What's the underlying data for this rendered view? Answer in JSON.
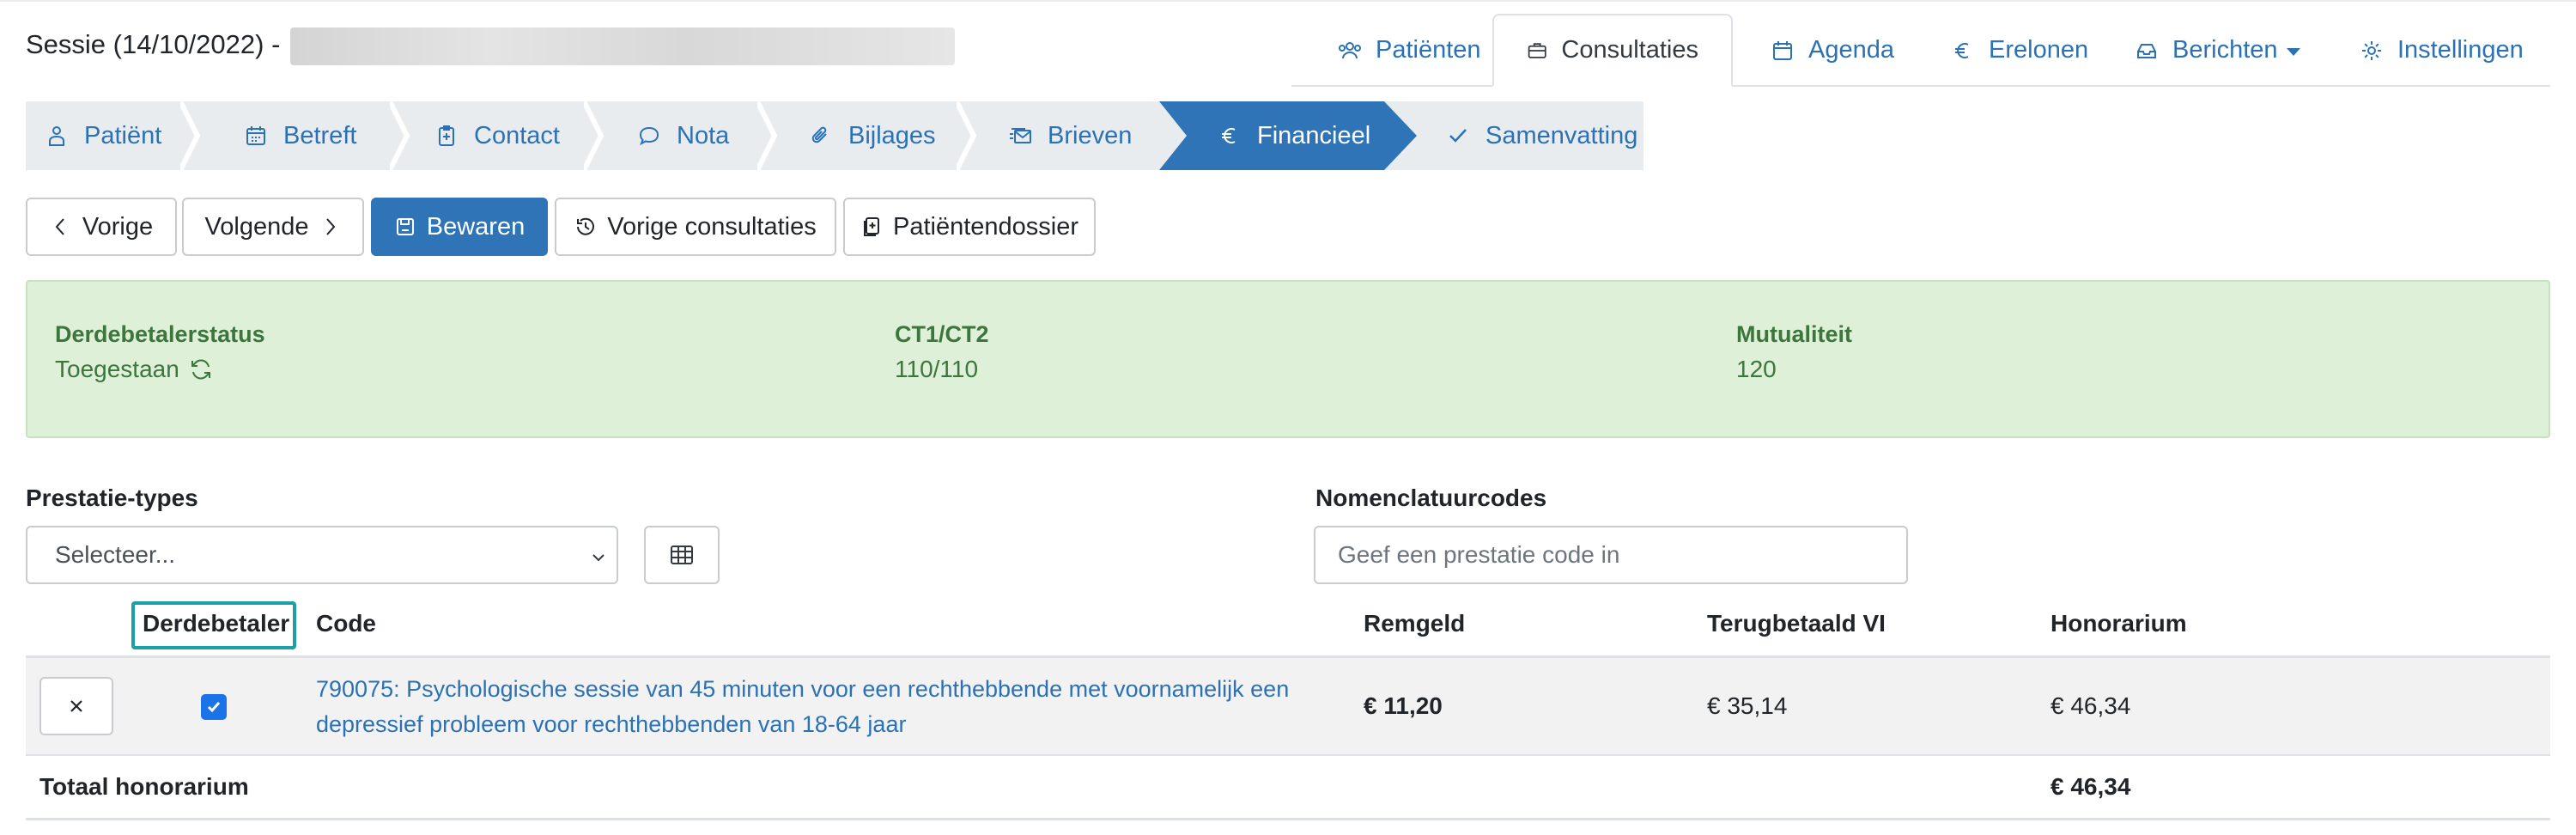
{
  "header": {
    "title": "Sessie (14/10/2022) -",
    "nav": [
      {
        "label": "Patiënten",
        "icon": "users-icon"
      },
      {
        "label": "Consultaties",
        "icon": "briefcase-icon",
        "active": true
      },
      {
        "label": "Agenda",
        "icon": "calendar-icon"
      },
      {
        "label": "Erelonen",
        "icon": "euro-icon"
      },
      {
        "label": "Berichten",
        "icon": "inbox-icon",
        "dropdown": true
      },
      {
        "label": "Instellingen",
        "icon": "gear-icon"
      }
    ]
  },
  "steps": [
    {
      "label": "Patiënt",
      "icon": "user-icon"
    },
    {
      "label": "Betreft",
      "icon": "calendar-icon"
    },
    {
      "label": "Contact",
      "icon": "clipboard-plus-icon"
    },
    {
      "label": "Nota",
      "icon": "chat-icon"
    },
    {
      "label": "Bijlages",
      "icon": "paperclip-icon"
    },
    {
      "label": "Brieven",
      "icon": "letters-icon"
    },
    {
      "label": "Financieel",
      "icon": "euro-icon",
      "active": true
    },
    {
      "label": "Samenvatting",
      "icon": "check-icon"
    }
  ],
  "actions": {
    "previous": "Vorige",
    "next": "Volgende",
    "save": "Bewaren",
    "previous_consultations": "Vorige consultaties",
    "patient_file": "Patiëntendossier"
  },
  "status": {
    "third_party_label": "Derdebetalerstatus",
    "third_party_value": "Toegestaan",
    "ct_label": "CT1/CT2",
    "ct_value": "110/110",
    "mutuality_label": "Mutualiteit",
    "mutuality_value": "120"
  },
  "form": {
    "service_types_label": "Prestatie-types",
    "service_types_selected": "Selecteer...",
    "codes_label": "Nomenclatuurcodes",
    "codes_placeholder": "Geef een prestatie code in"
  },
  "table": {
    "headers": {
      "third_party": "Derdebetaler",
      "code": "Code",
      "copay": "Remgeld",
      "refund": "Terugbetaald VI",
      "fee": "Honorarium"
    },
    "rows": [
      {
        "third_party_checked": true,
        "code": "790075: Psychologische sessie van 45 minuten voor een rechthebbende met voornamelijk een depressief probleem voor rechthebbenden van 18-64 jaar",
        "copay": "€ 11,20",
        "refund": "€ 35,14",
        "fee": "€ 46,34"
      }
    ],
    "total_label": "Totaal honorarium",
    "total_value": "€ 46,34"
  },
  "colors": {
    "link_blue": "#2b71b5",
    "primary_button": "#2e74b6",
    "success_bg": "#dff0d8",
    "success_text": "#3c763d",
    "focus_outline": "#1ba0a8"
  }
}
